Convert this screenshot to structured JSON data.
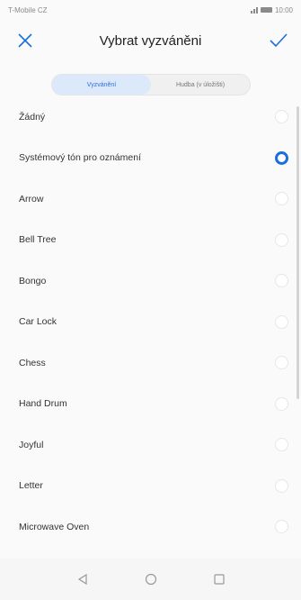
{
  "status_bar": {
    "carrier": "T-Mobile CZ",
    "time": "10:00"
  },
  "header": {
    "title": "Vybrat vyzváněni",
    "close_icon": "close-icon",
    "confirm_icon": "checkmark-icon"
  },
  "tabs": [
    {
      "label": "Vyzvánění",
      "active": true
    },
    {
      "label": "Hudba (v úložišti)",
      "active": false
    }
  ],
  "ringtones": [
    {
      "label": "Žádný",
      "selected": false
    },
    {
      "label": "Systémový tón pro oznámení",
      "selected": true
    },
    {
      "label": "Arrow",
      "selected": false
    },
    {
      "label": "Bell Tree",
      "selected": false
    },
    {
      "label": "Bongo",
      "selected": false
    },
    {
      "label": "Car Lock",
      "selected": false
    },
    {
      "label": "Chess",
      "selected": false
    },
    {
      "label": "Hand Drum",
      "selected": false
    },
    {
      "label": "Joyful",
      "selected": false
    },
    {
      "label": "Letter",
      "selected": false
    },
    {
      "label": "Microwave Oven",
      "selected": false
    }
  ],
  "colors": {
    "accent": "#1a6fe0"
  }
}
